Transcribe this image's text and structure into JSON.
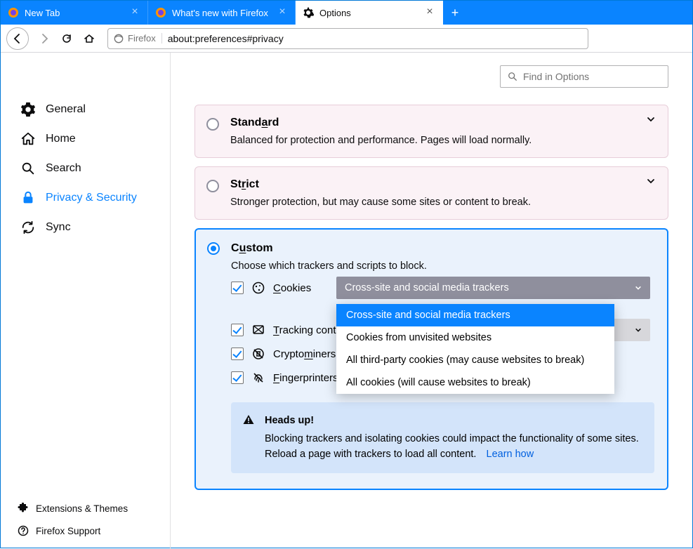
{
  "tabs": [
    {
      "label": "New Tab",
      "active": false
    },
    {
      "label": "What's new with Firefox",
      "active": false
    },
    {
      "label": "Options",
      "active": true
    }
  ],
  "url": {
    "chip": "Firefox",
    "address": "about:preferences#privacy"
  },
  "search": {
    "placeholder": "Find in Options"
  },
  "sidebar": {
    "items": [
      {
        "label": "General"
      },
      {
        "label": "Home"
      },
      {
        "label": "Search"
      },
      {
        "label": "Privacy & Security",
        "active": true
      },
      {
        "label": "Sync"
      }
    ],
    "bottom": [
      {
        "label": "Extensions & Themes"
      },
      {
        "label": "Firefox Support"
      }
    ]
  },
  "panels": {
    "standard": {
      "title_pre": "Stand",
      "title_ul": "a",
      "title_post": "rd",
      "desc": "Balanced for protection and performance. Pages will load normally."
    },
    "strict": {
      "title_pre": "St",
      "title_ul": "r",
      "title_post": "ict",
      "desc": "Stronger protection, but may cause some sites or content to break."
    },
    "custom": {
      "title_pre": "C",
      "title_ul": "u",
      "title_post": "stom",
      "desc": "Choose which trackers and scripts to block."
    }
  },
  "custom_opts": {
    "cookies": {
      "label_ul": "C",
      "label_rest": "ookies",
      "select_value": "Cross-site and social media trackers"
    },
    "tracking": {
      "label_ul": "T",
      "label_rest": "racking content"
    },
    "cryptominers": {
      "label_pre": "Crypto",
      "label_ul": "m",
      "label_rest": "iners"
    },
    "fingerprinters": {
      "label_ul": "F",
      "label_rest": "ingerprinters"
    }
  },
  "cookies_dropdown": [
    "Cross-site and social media trackers",
    "Cookies from unvisited websites",
    "All third-party cookies (may cause websites to break)",
    "All cookies (will cause websites to break)"
  ],
  "notice": {
    "title": "Heads up!",
    "body": "Blocking trackers and isolating cookies could impact the functionality of some sites. Reload a page with trackers to load all content.",
    "link": "Learn how"
  }
}
